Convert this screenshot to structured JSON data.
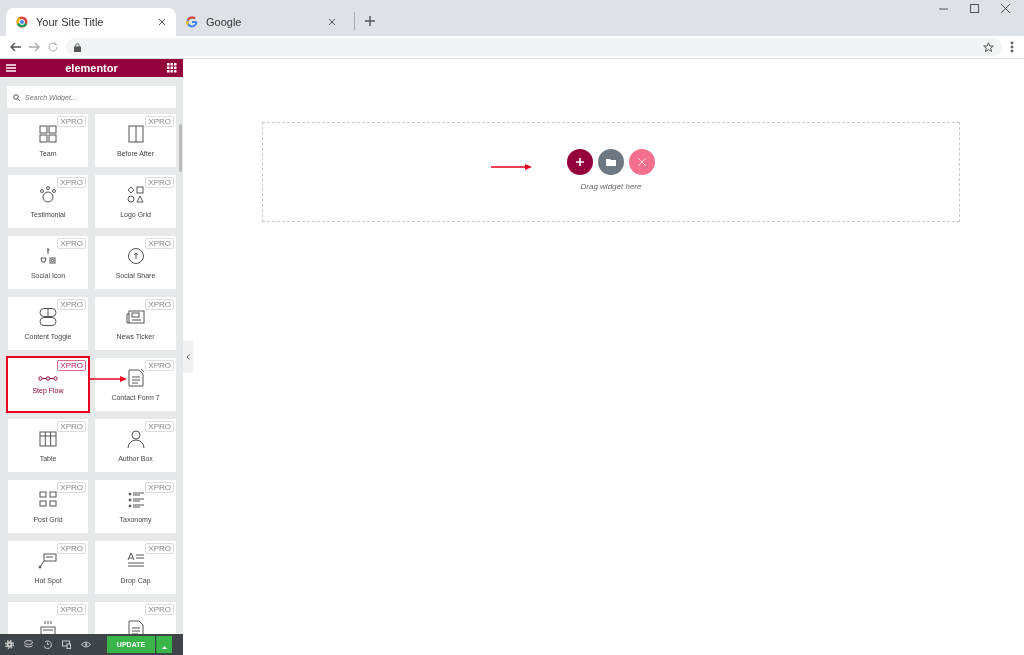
{
  "browser": {
    "tabs": [
      {
        "title": "Your Site Title",
        "selected": true,
        "kind": "chrome"
      },
      {
        "title": "Google",
        "selected": false,
        "kind": "google"
      }
    ]
  },
  "sidebar": {
    "brand": "elementor",
    "search": {
      "placeholder": "Search Widget..."
    },
    "widgets": [
      {
        "label": "Team",
        "badge": "XPRO",
        "kind": "team",
        "selected": false
      },
      {
        "label": "Before After",
        "badge": "XPRO",
        "kind": "before-after",
        "selected": false
      },
      {
        "label": "Testimonial",
        "badge": "XPRO",
        "kind": "testimonial",
        "selected": false
      },
      {
        "label": "Logo Grid",
        "badge": "XPRO",
        "kind": "logo-grid",
        "selected": false
      },
      {
        "label": "Social Icon",
        "badge": "XPRO",
        "kind": "social-icon",
        "selected": false
      },
      {
        "label": "Social Share",
        "badge": "XPRO",
        "kind": "social-share",
        "selected": false
      },
      {
        "label": "Content Toggle",
        "badge": "XPRO",
        "kind": "content-toggle",
        "selected": false
      },
      {
        "label": "News Ticker",
        "badge": "XPRO",
        "kind": "news-ticker",
        "selected": false
      },
      {
        "label": "Step Flow",
        "badge": "XPRO",
        "kind": "step-flow",
        "selected": true
      },
      {
        "label": "Contact Form 7",
        "badge": "XPRO",
        "kind": "contact-form",
        "selected": false
      },
      {
        "label": "Table",
        "badge": "XPRO",
        "kind": "table",
        "selected": false
      },
      {
        "label": "Author Box",
        "badge": "XPRO",
        "kind": "author-box",
        "selected": false
      },
      {
        "label": "Post Grid",
        "badge": "XPRO",
        "kind": "post-grid",
        "selected": false
      },
      {
        "label": "Taxonomy",
        "badge": "XPRO",
        "kind": "taxonomy",
        "selected": false
      },
      {
        "label": "Hot Spot",
        "badge": "XPRO",
        "kind": "hot-spot",
        "selected": false
      },
      {
        "label": "Drop Cap",
        "badge": "XPRO",
        "kind": "drop-cap",
        "selected": false
      },
      {
        "badge": "XPRO",
        "kind": "card-list",
        "selected": false
      },
      {
        "badge": "XPRO",
        "kind": "document",
        "selected": false
      }
    ],
    "update_button": "UPDATE"
  },
  "canvas": {
    "drop_hint": "Drag widget here"
  }
}
